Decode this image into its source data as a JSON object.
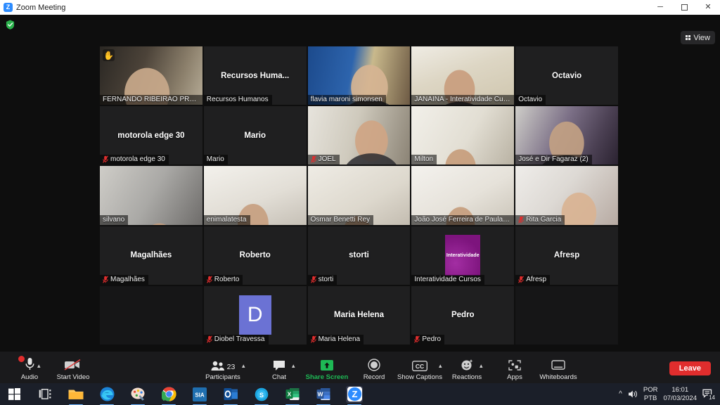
{
  "window": {
    "app_icon": "zoom-logo-icon",
    "app_letter": "Z",
    "title": "Zoom Meeting",
    "minimize": "─",
    "maximize": "❐",
    "close": "✕"
  },
  "topbar": {
    "encryption_icon": "green-shield-check-icon",
    "view_label": "View",
    "view_icon": "grid-icon"
  },
  "grid": {
    "columns": 5,
    "rows": 5,
    "tiles": [
      {
        "name": "FERNANDO RIBEIRAO PRETO",
        "mode": "video",
        "muted": false,
        "hand_raised": true,
        "hand_icon": "raised-hand-icon",
        "active": false,
        "scene": "office-dark"
      },
      {
        "name": "Recursos Humanos",
        "big_label": "Recursos  Huma...",
        "mode": "placeholder",
        "muted": false,
        "hand_raised": false,
        "active": false
      },
      {
        "name": "flavia maroni simonsen",
        "mode": "video",
        "muted": false,
        "hand_raised": false,
        "active": false,
        "scene": "blue-wall"
      },
      {
        "name": "JANAINA - Interatividade Curs...",
        "mode": "video",
        "muted": false,
        "hand_raised": false,
        "active": true,
        "scene": "bright-shelf"
      },
      {
        "name": "Octavio",
        "big_label": "Octavio",
        "mode": "placeholder",
        "muted": false,
        "hand_raised": false,
        "active": false
      },
      {
        "name": "motorola edge 30",
        "big_label": "motorola edge 30",
        "mode": "placeholder",
        "muted": true,
        "hand_raised": false,
        "active": false
      },
      {
        "name": "Mario",
        "big_label": "Mario",
        "mode": "placeholder",
        "muted": false,
        "hand_raised": false,
        "active": false
      },
      {
        "name": "JOEL",
        "mode": "video",
        "muted": true,
        "hand_raised": false,
        "active": false,
        "scene": "window-light"
      },
      {
        "name": "Milton",
        "mode": "video",
        "muted": false,
        "hand_raised": false,
        "active": false,
        "scene": "curtain"
      },
      {
        "name": "José e Dir Fagaraz (2)",
        "mode": "video",
        "muted": false,
        "hand_raised": false,
        "active": false,
        "scene": "room-purple"
      },
      {
        "name": "silvano",
        "mode": "video",
        "muted": false,
        "hand_raised": false,
        "active": false,
        "scene": "grey-sofa"
      },
      {
        "name": "enimalatesta",
        "mode": "video",
        "muted": false,
        "hand_raised": false,
        "active": false,
        "scene": "white-room"
      },
      {
        "name": "Osmar Benetti Rey",
        "mode": "video",
        "muted": false,
        "hand_raised": false,
        "active": false,
        "scene": "pale-wall"
      },
      {
        "name": "João José Ferreira de Paula S...",
        "mode": "video",
        "muted": false,
        "hand_raised": false,
        "active": false,
        "scene": "white-room2"
      },
      {
        "name": "Rita Garcia",
        "mode": "video",
        "muted": true,
        "hand_raised": false,
        "active": false,
        "scene": "corner-wall"
      },
      {
        "name": "Magalhães",
        "big_label": "Magalhães",
        "mode": "placeholder",
        "muted": true,
        "hand_raised": false,
        "active": false
      },
      {
        "name": "Roberto",
        "big_label": "Roberto",
        "mode": "placeholder",
        "muted": true,
        "hand_raised": false,
        "active": false
      },
      {
        "name": "storti",
        "big_label": "storti",
        "mode": "placeholder",
        "muted": true,
        "hand_raised": false,
        "active": false
      },
      {
        "name": "Interatividade Cursos",
        "mode": "logo",
        "logo_text": "Interatividade",
        "logo_color": "#8e1b8e",
        "muted": false,
        "hand_raised": false,
        "active": false
      },
      {
        "name": "Afresp",
        "big_label": "Afresp",
        "mode": "placeholder",
        "muted": true,
        "hand_raised": false,
        "active": false
      },
      {
        "name": "",
        "mode": "empty",
        "muted": false,
        "hand_raised": false,
        "active": false
      },
      {
        "name": "Diobel Travessa",
        "mode": "avatar",
        "avatar_letter": "D",
        "avatar_color": "#6b72d4",
        "muted": true,
        "hand_raised": false,
        "active": false
      },
      {
        "name": "Maria Helena",
        "big_label": "Maria Helena",
        "mode": "placeholder",
        "muted": true,
        "hand_raised": false,
        "active": false
      },
      {
        "name": "Pedro",
        "big_label": "Pedro",
        "mode": "placeholder",
        "muted": true,
        "hand_raised": false,
        "active": false
      },
      {
        "name": "",
        "mode": "empty",
        "muted": false,
        "hand_raised": false,
        "active": false
      }
    ]
  },
  "toolbar": {
    "audio": {
      "label": "Audio",
      "icon": "microphone-icon",
      "has_caret": true,
      "badge": true
    },
    "video": {
      "label": "Start Video",
      "icon": "camera-off-icon",
      "has_caret": false
    },
    "participants": {
      "label": "Participants",
      "icon": "people-icon",
      "count": "23",
      "has_caret": true
    },
    "chat": {
      "label": "Chat",
      "icon": "chat-bubble-icon",
      "has_caret": true
    },
    "share": {
      "label": "Share Screen",
      "icon": "share-screen-icon",
      "color": "#1eb955"
    },
    "record": {
      "label": "Record",
      "icon": "record-circle-icon"
    },
    "captions": {
      "label": "Show Captions",
      "icon": "cc-icon",
      "has_caret": true
    },
    "reactions": {
      "label": "Reactions",
      "icon": "smiley-icon",
      "has_caret": true
    },
    "apps": {
      "label": "Apps",
      "icon": "apps-icon"
    },
    "whiteboards": {
      "label": "Whiteboards",
      "icon": "whiteboard-icon"
    },
    "leave": {
      "label": "Leave",
      "color": "#e02d2d"
    }
  },
  "taskbar": {
    "items": [
      {
        "name": "start-button",
        "icon": "windows-logo-icon"
      },
      {
        "name": "task-view-button",
        "icon": "task-view-icon"
      },
      {
        "name": "file-explorer",
        "icon": "folder-icon",
        "running": true
      },
      {
        "name": "microsoft-edge",
        "icon": "edge-icon",
        "running": true
      },
      {
        "name": "paint",
        "icon": "paint-icon",
        "running": true
      },
      {
        "name": "google-chrome",
        "icon": "chrome-icon",
        "running": true
      },
      {
        "name": "sia-app",
        "icon": "sia-icon",
        "label": "SIA",
        "running": true
      },
      {
        "name": "microsoft-outlook",
        "icon": "outlook-icon",
        "running": true
      },
      {
        "name": "skype",
        "icon": "skype-icon",
        "running": true
      },
      {
        "name": "microsoft-excel",
        "icon": "excel-icon",
        "label": "X",
        "running": true
      },
      {
        "name": "microsoft-word",
        "icon": "word-icon",
        "label": "W",
        "running": true
      },
      {
        "name": "zoom-app",
        "icon": "zoom-icon",
        "label": "Z",
        "running": true,
        "selected": true
      }
    ],
    "tray": {
      "overflow_icon": "chevron-up-icon",
      "volume_icon": "speaker-icon",
      "language_line1": "POR",
      "language_line2": "PTB",
      "time": "16:01",
      "date": "07/03/2024",
      "notifications_icon": "notification-icon",
      "notification_count": "14"
    }
  }
}
